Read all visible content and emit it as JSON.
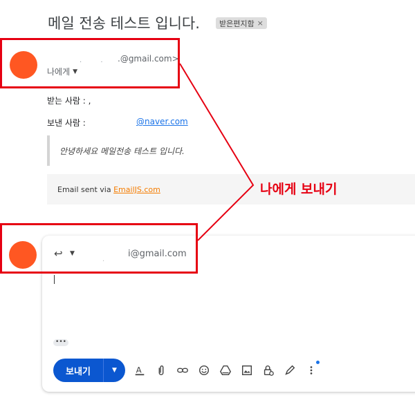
{
  "email": {
    "subject": "메일 전송 테스트 입니다.",
    "label": "받은편지함",
    "label_close": "×",
    "sender_email": ".@gmail.com>",
    "sender_dots": ". .",
    "to_me": "나에게",
    "to_field": "받는 사람 : ,",
    "from_field": "보낸 사람 :",
    "from_link": "@naver.com",
    "body_quote": "안녕하세요 메일전송 테스트 입니다.",
    "footer_prefix": "Email sent via ",
    "footer_link": "EmailJS.com"
  },
  "reply": {
    "dot": ".",
    "to": "i@gmail.com",
    "more_label": "•••",
    "send_label": "보내기"
  },
  "toolbar": {
    "icons": [
      "text-format-icon",
      "attach-icon",
      "link-icon",
      "emoji-icon",
      "drive-icon",
      "photo-icon",
      "confidential-icon",
      "signature-icon",
      "more-options-icon"
    ]
  },
  "annotation": {
    "label": "나에게 보내기",
    "color": "#e60012"
  },
  "colors": {
    "avatar": "#ff5722",
    "send_button": "#0b57d0",
    "link": "#1a73e8",
    "footer_link": "#f57c00"
  }
}
